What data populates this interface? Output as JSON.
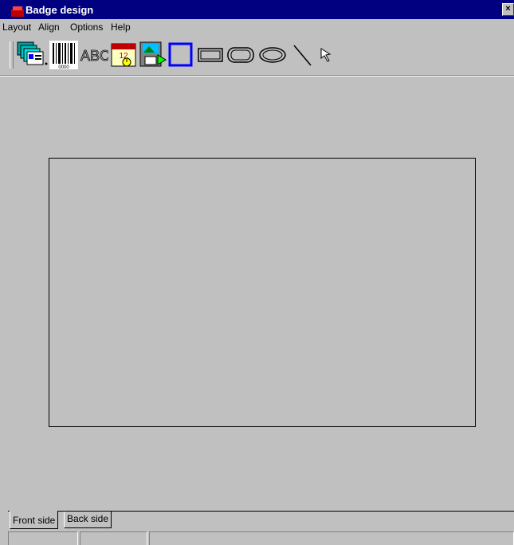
{
  "window": {
    "title": "Badge design",
    "close_glyph": "×"
  },
  "menu": {
    "items": [
      "Layout",
      "Align",
      "Options",
      "Help"
    ]
  },
  "toolbar": {
    "tools": [
      {
        "name": "card-stack-icon"
      },
      {
        "name": "barcode-icon"
      },
      {
        "name": "text-abc-icon",
        "text": "ABC"
      },
      {
        "name": "date-time-icon"
      },
      {
        "name": "image-import-icon"
      },
      {
        "name": "square-frame-icon",
        "accent": "#0000ff"
      },
      {
        "name": "rectangle-icon"
      },
      {
        "name": "rounded-rectangle-icon"
      },
      {
        "name": "ellipse-icon"
      },
      {
        "name": "line-icon"
      },
      {
        "name": "pointer-arrow-icon"
      }
    ]
  },
  "tabs": {
    "front_label": "Front side",
    "back_label": "Back side",
    "active": "Front side"
  },
  "colors": {
    "titlebar": "#000080",
    "face": "#c0c0c0",
    "accent_blue": "#0000ff"
  }
}
